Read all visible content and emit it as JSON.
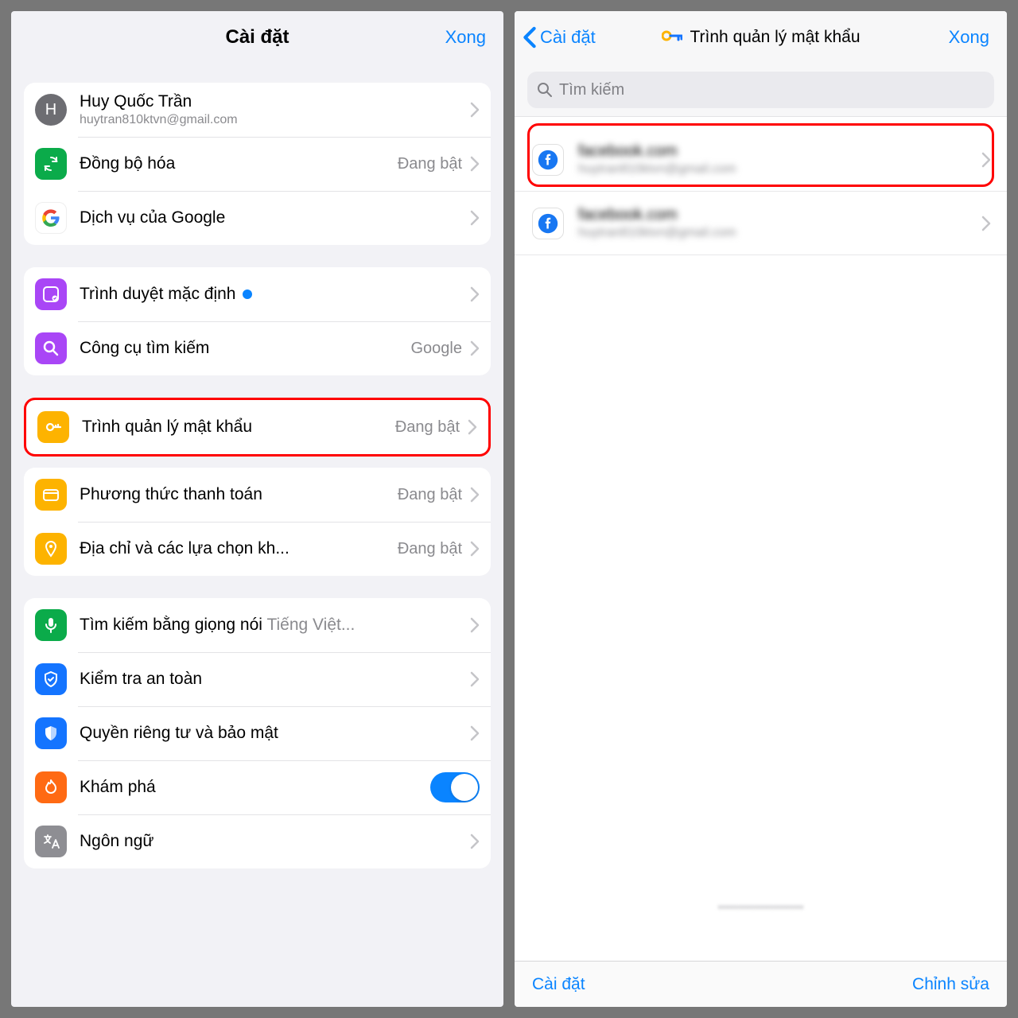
{
  "left": {
    "title": "Cài đặt",
    "done": "Xong",
    "account": {
      "initial": "H",
      "name": "Huy Quốc Trần",
      "email": "huytran810ktvn@gmail.com"
    },
    "sync": {
      "label": "Đồng bộ hóa",
      "value": "Đang bật"
    },
    "google": {
      "label": "Dịch vụ của Google"
    },
    "defaultBrowser": {
      "label": "Trình duyệt mặc định"
    },
    "searchEngine": {
      "label": "Công cụ tìm kiếm",
      "value": "Google"
    },
    "passwords": {
      "label": "Trình quản lý mật khẩu",
      "value": "Đang bật"
    },
    "payment": {
      "label": "Phương thức thanh toán",
      "value": "Đang bật"
    },
    "address": {
      "label": "Địa chỉ và các lựa chọn kh...",
      "value": "Đang bật"
    },
    "voice": {
      "label": "Tìm kiếm bằng giọng nói",
      "value": "Tiếng Việt..."
    },
    "safety": {
      "label": "Kiểm tra an toàn"
    },
    "privacy": {
      "label": "Quyền riêng tư và bảo mật"
    },
    "discover": {
      "label": "Khám phá"
    },
    "language": {
      "label": "Ngôn ngữ"
    }
  },
  "right": {
    "back": "Cài đặt",
    "title": "Trình quản lý mật khẩu",
    "done": "Xong",
    "searchPlaceholder": "Tìm kiếm",
    "items": [
      {
        "site": "facebook.com",
        "user": "huytran810ktvn@gmail.com"
      },
      {
        "site": "facebook.com",
        "user": "huytran810ktvn@gmail.com"
      }
    ],
    "footer": {
      "left": "Cài đặt",
      "right": "Chỉnh sửa"
    }
  }
}
